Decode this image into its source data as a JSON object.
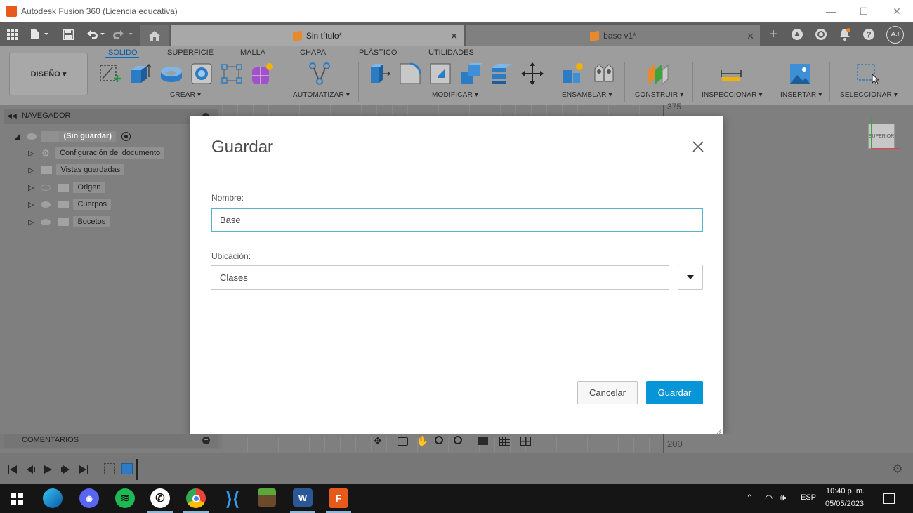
{
  "window": {
    "title": "Autodesk Fusion 360 (Licencia educativa)",
    "minimize": "—",
    "maximize": "☐",
    "close": "✕"
  },
  "tabs": [
    {
      "label": "Sin título*",
      "active": true
    },
    {
      "label": "base v1*",
      "active": false
    }
  ],
  "user": {
    "initials": "AJ"
  },
  "ribbon": {
    "workspace": "DISEÑO ▾",
    "tabs": [
      "SOLIDO",
      "SUPERFICIE",
      "MALLA",
      "CHAPA",
      "PLÁSTICO",
      "UTILIDADES"
    ],
    "groups": [
      "CREAR ▾",
      "AUTOMATIZAR ▾",
      "MODIFICAR ▾",
      "ENSAMBLAR ▾",
      "CONSTRUIR ▾",
      "INSPECCIONAR ▾",
      "INSERTAR ▾",
      "SELECCIONAR ▾"
    ]
  },
  "browser": {
    "title": "NAVEGADOR",
    "root": "(Sin guardar)",
    "items": [
      "Configuración del documento",
      "Vistas guardadas",
      "Origen",
      "Cuerpos",
      "Bocetos"
    ]
  },
  "viewcube": {
    "label": "SUPERIOR"
  },
  "ruler": {
    "top": "375",
    "bottom": "200"
  },
  "comments": {
    "label": "COMENTARIOS"
  },
  "dialog": {
    "title": "Guardar",
    "name_label": "Nombre:",
    "name_value": "Base",
    "location_label": "Ubicación:",
    "location_value": "Clases",
    "cancel": "Cancelar",
    "save": "Guardar"
  },
  "taskbar": {
    "lang": "ESP",
    "time": "10:40 p. m.",
    "date": "05/05/2023"
  },
  "colors": {
    "accent": "#0696d7",
    "focus": "#59b4c9",
    "ribbon": "#9d9d9d",
    "tabbar": "#5e5e5e"
  }
}
